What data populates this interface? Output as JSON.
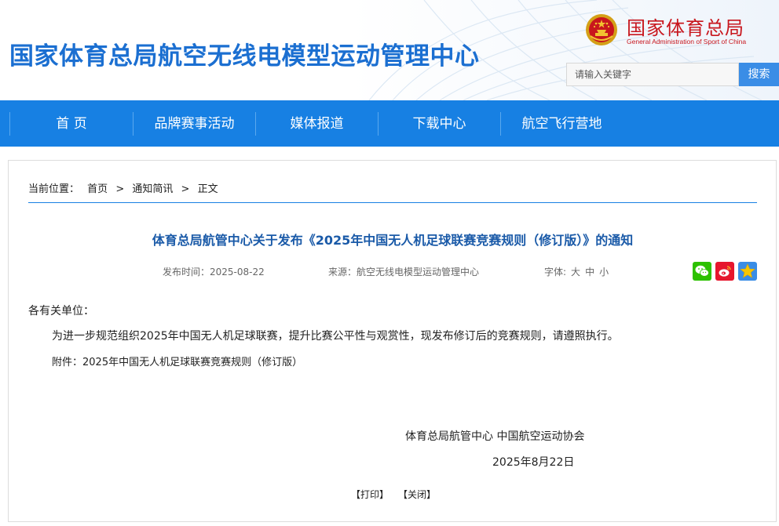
{
  "header": {
    "site_title": "国家体育总局航空无线电模型运动管理中心",
    "logo_cn": "国家体育总局",
    "logo_en": "General Administration of Sport of China"
  },
  "search": {
    "placeholder": "请输入关键字",
    "button_label": "搜索"
  },
  "nav": {
    "items": [
      {
        "label": "首 页"
      },
      {
        "label": "品牌赛事活动"
      },
      {
        "label": "媒体报道"
      },
      {
        "label": "下载中心"
      },
      {
        "label": "航空飞行营地"
      }
    ]
  },
  "breadcrumb": {
    "prefix": "当前位置：",
    "items": [
      "首页",
      ">",
      "通知简讯",
      ">",
      "正文"
    ]
  },
  "article": {
    "title": "体育总局航管中心关于发布《2025年中国无人机足球联赛竞赛规则（修订版）》的通知",
    "publish_time": "发布时间：2025-08-22",
    "source": "来源：航空无线电模型运动管理中心",
    "font_size_label": "字体:",
    "font_sizes": [
      "大",
      "中",
      "小"
    ],
    "salutation": "各有关单位：",
    "body": "为进一步规范组织2025年中国无人机足球联赛，提升比赛公平性与观赏性，现发布修订后的竞赛规则，请遵照执行。",
    "attachment": "附件：2025年中国无人机足球联赛竞赛规则（修订版）",
    "signatories": "体育总局航管中心  中国航空运动协会",
    "date": "2025年8月22日"
  },
  "share": {
    "icons": [
      "wechat-icon",
      "weibo-icon",
      "favorite-star-icon"
    ],
    "colors": {
      "wechat": "#2dc100",
      "weibo": "#e6162d",
      "star": "#3a8de6"
    }
  },
  "footer_links": {
    "print": "【打印】",
    "close": "【关闭】"
  },
  "colors": {
    "title_blue": "#1b6fd1",
    "nav_blue": "#1780e3",
    "logo_red": "#c8161d",
    "article_title": "#1a5aa8"
  }
}
